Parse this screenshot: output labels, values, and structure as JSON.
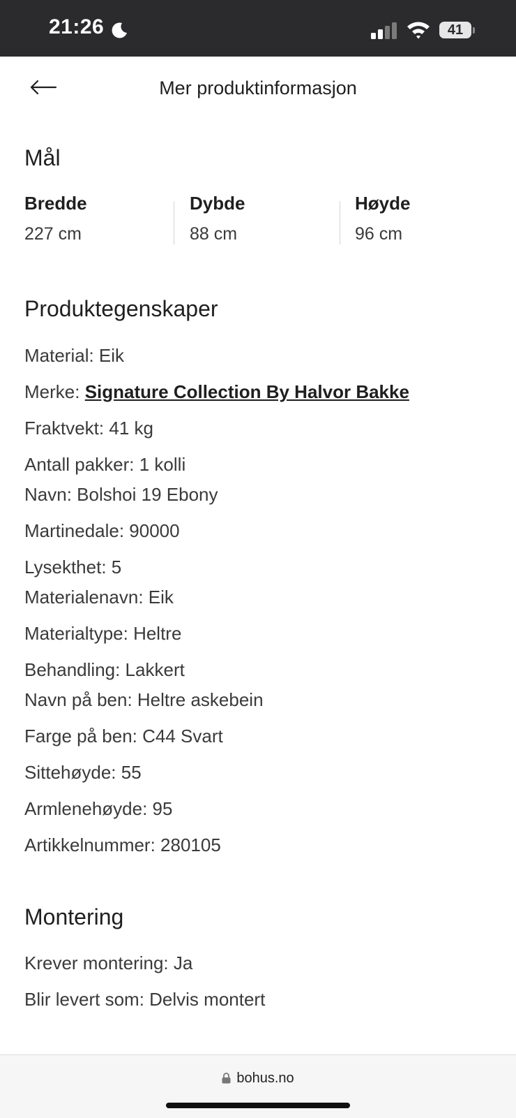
{
  "status_bar": {
    "time": "21:26",
    "battery": "41"
  },
  "header": {
    "title": "Mer produktinformasjon"
  },
  "dimensions": {
    "title": "Mål",
    "items": [
      {
        "label": "Bredde",
        "value": "227 cm"
      },
      {
        "label": "Dybde",
        "value": "88 cm"
      },
      {
        "label": "Høyde",
        "value": "96 cm"
      }
    ]
  },
  "properties": {
    "title": "Produktegenskaper",
    "material": "Material: Eik",
    "brand_prefix": "Merke: ",
    "brand_link": "Signature Collection By Halvor Bakke",
    "items": [
      "Fraktvekt: 41 kg",
      "Antall pakker: 1 kolli",
      "Navn: Bolshoi 19 Ebony",
      "Martinedale: 90000",
      "Lysekthet: 5",
      "Materialenavn: Eik",
      "Materialtype: Heltre",
      "Behandling: Lakkert",
      "Navn på ben: Heltre askebein",
      "Farge på ben: C44 Svart",
      "Sittehøyde: 55",
      "Armlenehøyde: 95",
      "Artikkelnummer: 280105"
    ]
  },
  "assembly": {
    "title": "Montering",
    "items": [
      "Krever montering: Ja",
      "Blir levert som: Delvis montert"
    ]
  },
  "browser": {
    "url": "bohus.no"
  }
}
